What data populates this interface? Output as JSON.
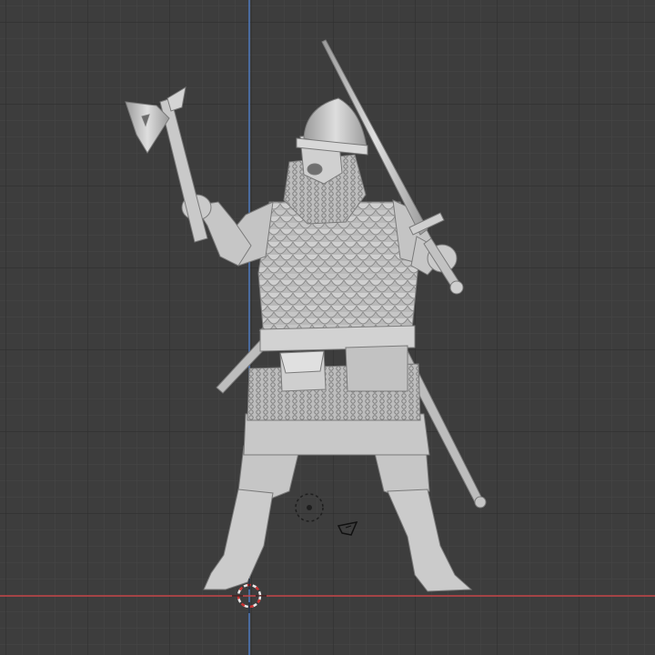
{
  "viewport": {
    "background": "#3d3d3d",
    "grid_minor_color": "#454545",
    "grid_major_color": "#2e2e2e",
    "x_axis_color": "#c8484c",
    "z_axis_color": "#4f7bc0"
  },
  "model": {
    "material_color": "#c8c8c8",
    "shadow_color": "#8a8a8a"
  },
  "icons": {
    "origin_marker": "circle-dot-icon",
    "camera": "camera-icon",
    "cursor": "3d-cursor-icon"
  }
}
